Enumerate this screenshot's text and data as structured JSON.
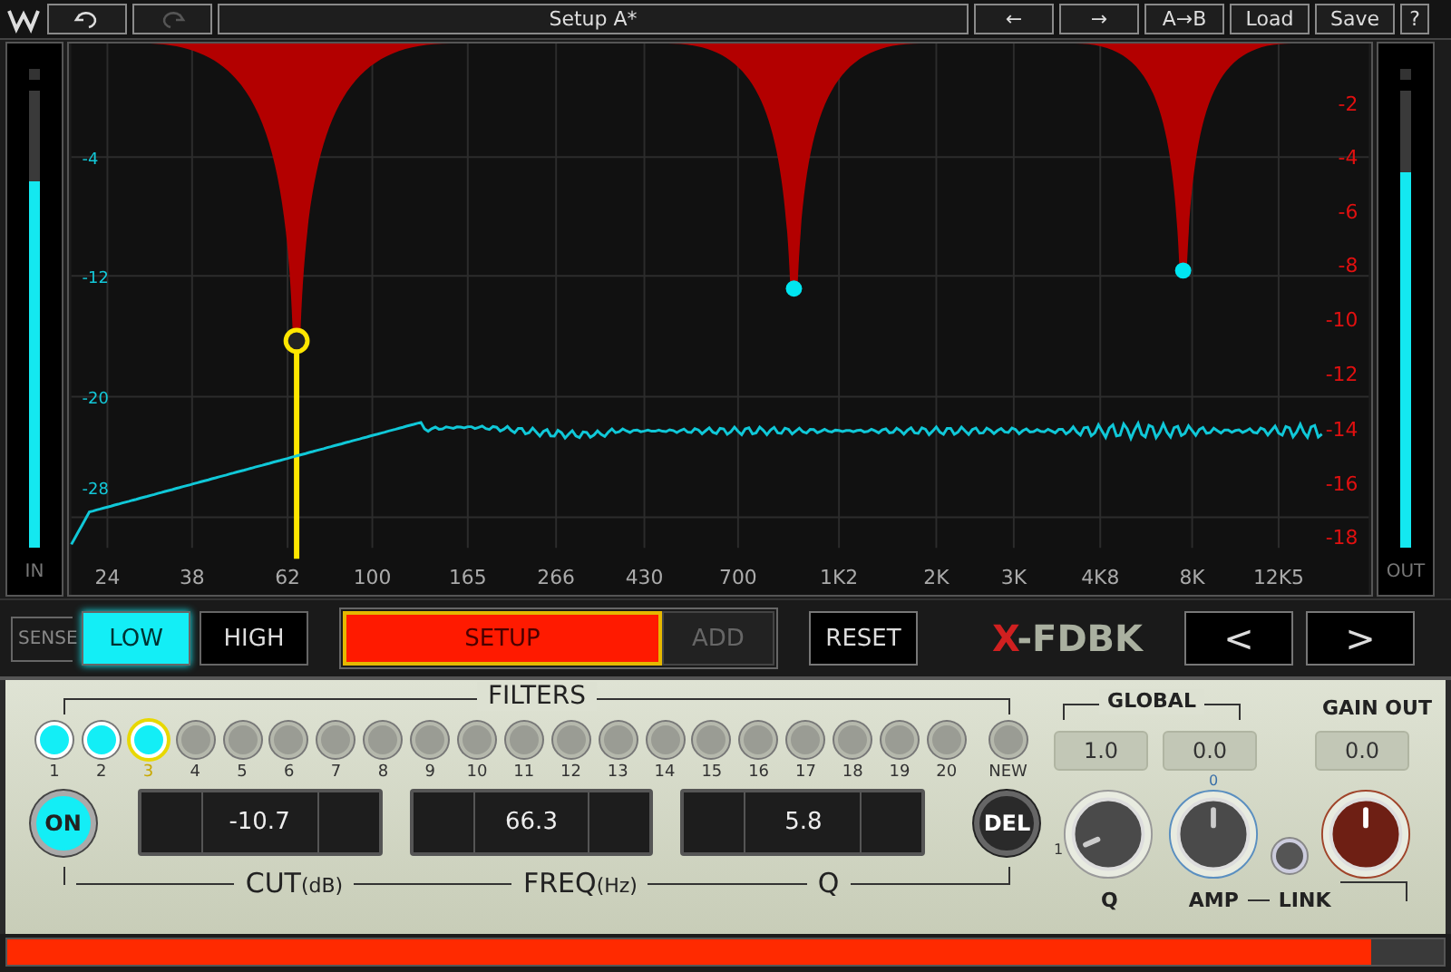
{
  "toolbar": {
    "undo": {
      "disabled": false
    },
    "redo": {
      "disabled": true
    },
    "preset_name": "Setup A*",
    "buttons": [
      {
        "label": "←"
      },
      {
        "label": "→"
      },
      {
        "label": "A→B"
      },
      {
        "label": "Load"
      },
      {
        "label": "Save"
      },
      {
        "label": "?"
      }
    ]
  },
  "meters": [
    {
      "label": "IN",
      "level": 0.8
    },
    {
      "label": "OUT",
      "level": 0.82
    }
  ],
  "graph": {
    "x_labels": [
      "24",
      "38",
      "62",
      "100",
      "165",
      "266",
      "430",
      "700",
      "1K2",
      "2K",
      "3K",
      "4K8",
      "8K",
      "12K5"
    ],
    "level_labels": [
      "-4",
      "-12",
      "-20",
      "-28"
    ],
    "cut_labels": [
      "-2",
      "-4",
      "-6",
      "-8",
      "-10",
      "-12",
      "-14",
      "-16",
      "-18"
    ]
  },
  "sense": {
    "label": "SENSE",
    "modes": [
      {
        "label": "LOW",
        "selected": true
      },
      {
        "label": "HIGH",
        "selected": false
      }
    ]
  },
  "setup": {
    "label": "SETUP",
    "on": true
  },
  "add": {
    "label": "ADD",
    "disabled": true
  },
  "reset": "RESET",
  "logo": {
    "mark": "X",
    "text": "-FDBK"
  },
  "nav": [
    "<",
    ">"
  ],
  "filters": {
    "title": "FILTERS",
    "new_label": "NEW",
    "items": [
      {
        "label": "1",
        "active": true,
        "selected": false
      },
      {
        "label": "2",
        "active": true,
        "selected": false
      },
      {
        "label": "3",
        "active": true,
        "selected": true
      },
      {
        "label": "4",
        "active": false,
        "selected": false
      },
      {
        "label": "5",
        "active": false,
        "selected": false
      },
      {
        "label": "6",
        "active": false,
        "selected": false
      },
      {
        "label": "7",
        "active": false,
        "selected": false
      },
      {
        "label": "8",
        "active": false,
        "selected": false
      },
      {
        "label": "9",
        "active": false,
        "selected": false
      },
      {
        "label": "10",
        "active": false,
        "selected": false
      },
      {
        "label": "11",
        "active": false,
        "selected": false
      },
      {
        "label": "12",
        "active": false,
        "selected": false
      },
      {
        "label": "13",
        "active": false,
        "selected": false
      },
      {
        "label": "14",
        "active": false,
        "selected": false
      },
      {
        "label": "15",
        "active": false,
        "selected": false
      },
      {
        "label": "16",
        "active": false,
        "selected": false
      },
      {
        "label": "17",
        "active": false,
        "selected": false
      },
      {
        "label": "18",
        "active": false,
        "selected": false
      },
      {
        "label": "19",
        "active": false,
        "selected": false
      },
      {
        "label": "20",
        "active": false,
        "selected": false
      }
    ]
  },
  "on_button": {
    "label": "ON",
    "on": true
  },
  "del_label": "DEL",
  "params": [
    {
      "value": "-10.7",
      "name": "CUT",
      "unit": "(dB)"
    },
    {
      "value": "66.3",
      "name": "FREQ",
      "unit": "(Hz)"
    },
    {
      "value": "5.8",
      "name": "Q"
    }
  ],
  "global": {
    "title": "GLOBAL",
    "values": [
      "1.0",
      "0.0"
    ],
    "q_tick": "1",
    "amp_tick": "0",
    "q_label": "Q",
    "amp_label": "AMP",
    "link_label": "LINK"
  },
  "gain_out": {
    "title": "GAIN OUT",
    "value": "0.0"
  },
  "progress": {
    "level": 0.95
  }
}
